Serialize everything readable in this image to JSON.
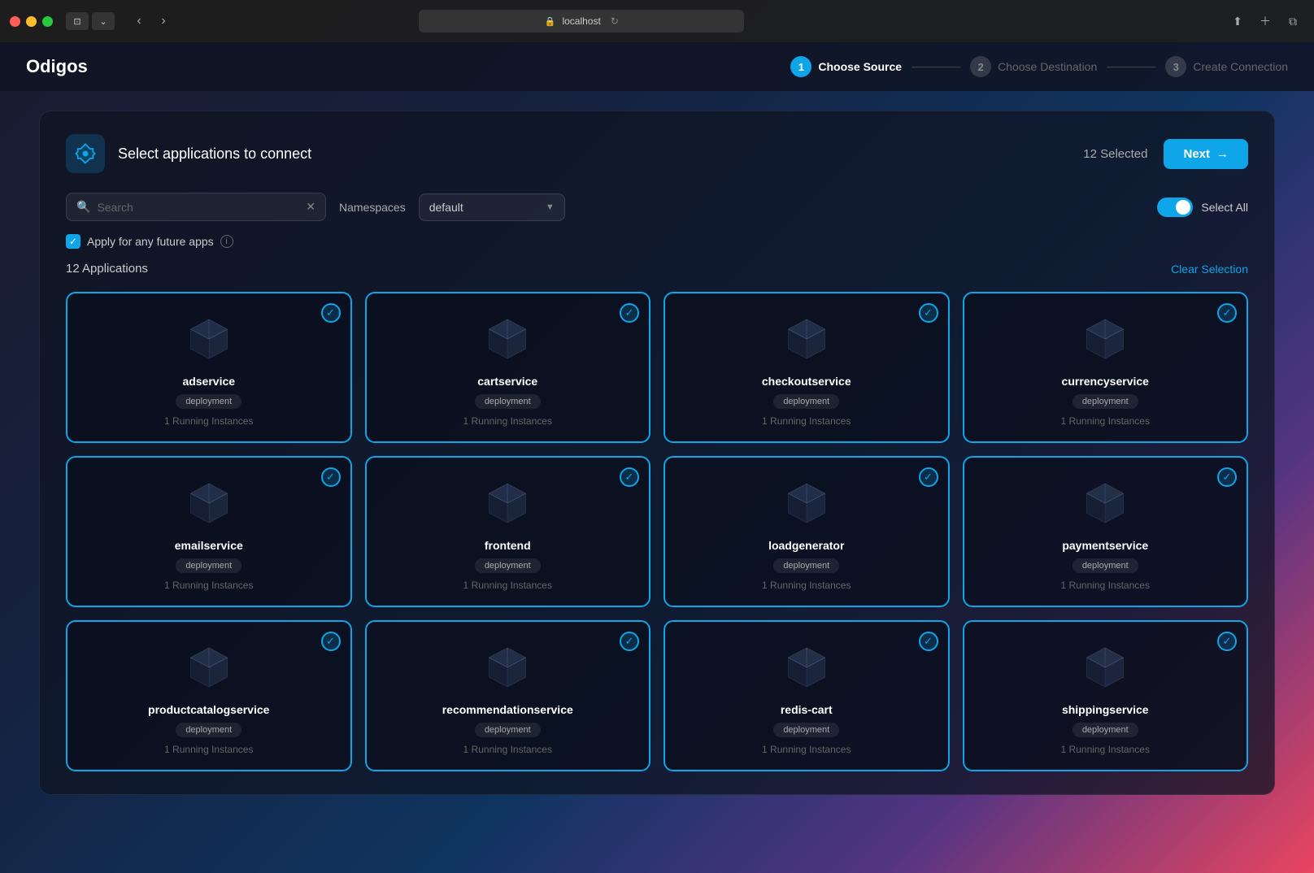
{
  "titlebar": {
    "url": "localhost",
    "reload_icon": "↻"
  },
  "header": {
    "logo": "Odigos",
    "steps": [
      {
        "num": "1",
        "label": "Choose Source",
        "active": true
      },
      {
        "num": "2",
        "label": "Choose Destination",
        "active": false
      },
      {
        "num": "3",
        "label": "Create Connection",
        "active": false
      }
    ]
  },
  "main": {
    "card_title": "Select applications to connect",
    "card_icon": "🔌",
    "selected_count": "12 Selected",
    "next_button": "Next",
    "search_placeholder": "Search",
    "namespace_label": "Namespaces",
    "namespace_value": "default",
    "select_all_label": "Select All",
    "apply_future_label": "Apply for any future apps",
    "app_count_label": "12 Applications",
    "clear_selection_label": "Clear Selection",
    "apps": [
      {
        "name": "adservice",
        "badge": "deployment",
        "instances": "1 Running Instances"
      },
      {
        "name": "cartservice",
        "badge": "deployment",
        "instances": "1 Running Instances"
      },
      {
        "name": "checkoutservice",
        "badge": "deployment",
        "instances": "1 Running Instances"
      },
      {
        "name": "currencyservice",
        "badge": "deployment",
        "instances": "1 Running Instances"
      },
      {
        "name": "emailservice",
        "badge": "deployment",
        "instances": "1 Running Instances"
      },
      {
        "name": "frontend",
        "badge": "deployment",
        "instances": "1 Running Instances"
      },
      {
        "name": "loadgenerator",
        "badge": "deployment",
        "instances": "1 Running Instances"
      },
      {
        "name": "paymentservice",
        "badge": "deployment",
        "instances": "1 Running Instances"
      },
      {
        "name": "productcatalogservice",
        "badge": "deployment",
        "instances": "1 Running Instances"
      },
      {
        "name": "recommendationservice",
        "badge": "deployment",
        "instances": "1 Running Instances"
      },
      {
        "name": "redis-cart",
        "badge": "deployment",
        "instances": "1 Running Instances"
      },
      {
        "name": "shippingservice",
        "badge": "deployment",
        "instances": "1 Running Instances"
      }
    ]
  }
}
